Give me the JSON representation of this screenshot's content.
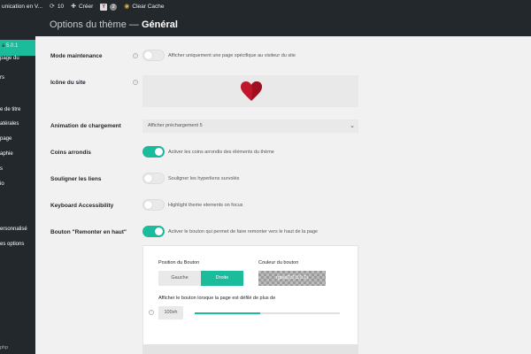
{
  "adminbar": {
    "site_name": "unication en V...",
    "updates_count": "10",
    "new_label": "Créer",
    "notifications_count": "2",
    "clear_cache_label": "Clear Cache"
  },
  "sidebar": {
    "brand": "a",
    "version": "5.0.1",
    "items": [
      "page du",
      "rs",
      "",
      "e de titre",
      "atérales",
      "page",
      "aphie",
      "s",
      "io",
      "ersonnalisé",
      "es options"
    ],
    "footer": "php"
  },
  "header": {
    "title_prefix": "Options du thème — ",
    "title_bold": "Général"
  },
  "settings": {
    "maintenance": {
      "label": "Mode maintenance",
      "desc": "Afficher uniquement une page spécifique au visiteur du site",
      "on": false
    },
    "site_icon": {
      "label": "Icône du site"
    },
    "loading_animation": {
      "label": "Animation de chargement",
      "value": "Afficher préchargement 5"
    },
    "rounded_corners": {
      "label": "Coins arrondis",
      "desc": "Activer les coins arrondis des éléments du thème",
      "on": true
    },
    "underline_links": {
      "label": "Souligner les liens",
      "desc": "Souligner les hyperliens survolés",
      "on": false
    },
    "keyboard": {
      "label": "Keyboard Accessibility",
      "desc": "Highlight theme elements on focus",
      "on": false
    },
    "back_to_top": {
      "label": "Bouton \"Remonter en haut\"",
      "desc": "Activer le bouton qui permet de faire remonter vers le haut de la page",
      "on": true,
      "position_label": "Position du Bouton",
      "position_left": "Gauche",
      "position_right": "Droite",
      "color_label": "Couleur du bouton",
      "color_value": "rgba(0,0,0,0.1)",
      "scroll_label": "Afficher le bouton lorsque la page est défilé de plus de",
      "scroll_value": "100vh",
      "scroll_fraction": 0.45
    }
  },
  "colors": {
    "accent": "#1abc9c",
    "heart": "#c0152a"
  },
  "icons": {
    "updates": "refresh-icon",
    "new": "plus-icon",
    "seo": "yoast-icon",
    "cache": "cache-icon",
    "help": "help-circle-icon",
    "select": "chevron-down-icon",
    "site_icon": "heart-icon"
  }
}
